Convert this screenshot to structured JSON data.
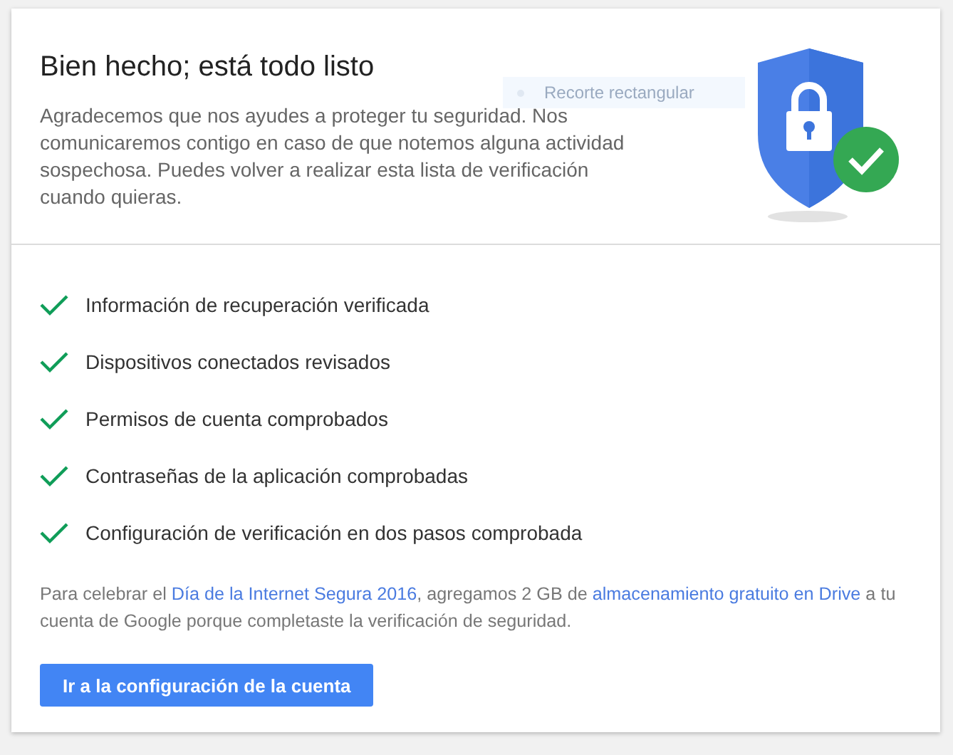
{
  "header": {
    "title": "Bien hecho; está todo listo",
    "description": "Agradecemos que nos ayudes a proteger tu seguridad. Nos comunicaremos contigo en caso de que notemos alguna actividad sospechosa. Puedes volver a realizar esta lista de verificación cuando quieras."
  },
  "snip_tooltip": {
    "label": "Recorte rectangular"
  },
  "checklist": [
    {
      "label": "Información de recuperación verificada",
      "checked": true
    },
    {
      "label": "Dispositivos conectados revisados",
      "checked": true
    },
    {
      "label": "Permisos de cuenta comprobados",
      "checked": true
    },
    {
      "label": "Contraseñas de la aplicación comprobadas",
      "checked": true
    },
    {
      "label": "Configuración de verificación en dos pasos comprobada",
      "checked": true
    }
  ],
  "note": [
    {
      "kind": "text",
      "text": "Para celebrar el "
    },
    {
      "kind": "link",
      "text": "Día de la Internet Segura 2016"
    },
    {
      "kind": "text",
      "text": ", agregamos 2 GB de "
    },
    {
      "kind": "link",
      "text": "almacenamiento gratuito en Drive"
    },
    {
      "kind": "text",
      "text": " a tu cuenta de Google porque completaste la verificación de seguridad."
    }
  ],
  "button": {
    "label": "Ir a la configuración de la cuenta"
  }
}
